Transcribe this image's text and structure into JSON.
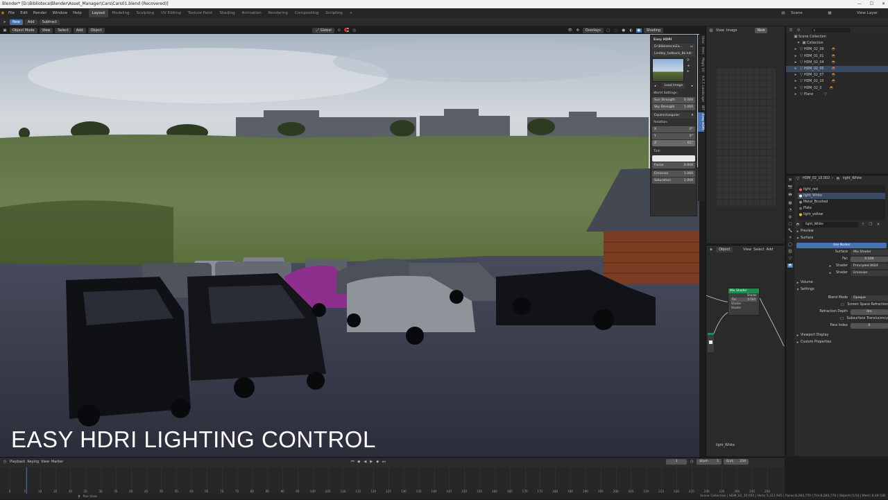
{
  "window": {
    "title": "Blender* [D:\\Biblioteca\\Blender\\Asset_Manager\\Cars\\Cars01.blend (Recovered)]"
  },
  "menu": [
    "File",
    "Edit",
    "Render",
    "Window",
    "Help"
  ],
  "workspaces": [
    "Layout",
    "Modeling",
    "Sculpting",
    "UV Editing",
    "Texture Paint",
    "Shading",
    "Animation",
    "Rendering",
    "Compositing",
    "Scripting"
  ],
  "top_right": {
    "scene": "Scene",
    "view_layer": "View Layer"
  },
  "toolbar": {
    "new": "New",
    "add": "Add",
    "subtract": "Subtract"
  },
  "viewport_header": {
    "mode": "Object Mode",
    "menus": [
      "View",
      "Select",
      "Add",
      "Object"
    ],
    "orientation": "Global",
    "overlays": "Overlays",
    "shading": "Shading"
  },
  "caption": "EASY HDRI LIGHTING CONTROL",
  "easy_hdri": {
    "panel_title": "Easy HDRI",
    "folder": "D:\\Biblioteca\\Ea...",
    "file": "Lindley_hotback_8k.hdr",
    "load_image": "Load Image",
    "world_settings": "World Settings:",
    "sun_strength_label": "Sun Strength",
    "sun_strength": "0.000",
    "sky_strength_label": "Sky Strength",
    "sky_strength": "1.000",
    "projection": "Equirectangular",
    "rotation_label": "Rotation:",
    "rot_x_label": "X",
    "rot_x": "0°",
    "rot_y_label": "Y",
    "rot_y": "0°",
    "rot_z_label": "Z",
    "rot_z": "61°",
    "tint_label": "Tint:",
    "factor_label": "Factor",
    "factor": "0.000",
    "emission_label": "Emission",
    "emission": "1.000",
    "saturation_label": "Saturation",
    "saturation": "1.000"
  },
  "npanel_tabs": [
    "Easy HDRI",
    "Tool",
    "Mult.Cmp.",
    "BIT",
    "A.R.T. Landscape",
    "Magic UV",
    "Item",
    "View"
  ],
  "image_editor": {
    "menus": [
      "View",
      "Image"
    ],
    "new": "New"
  },
  "node_editor": {
    "mode": "Object",
    "menus": [
      "View",
      "Select",
      "Add"
    ],
    "node_title": "Mix Shader",
    "socket_out": "Shader",
    "fac_label": "Fac",
    "fac": "0.500",
    "shader_a": "Shader",
    "shader_b": "Shader",
    "material_name": "light_White"
  },
  "outliner": {
    "collection_root": "Scene Collection",
    "items": [
      "Collection",
      "HDM_02_09",
      "HDM_01_01",
      "HDM_02_04",
      "HDM_02_05",
      "HDM_02_07",
      "HDM_02_10",
      "HDM_02_0",
      "Plane"
    ]
  },
  "properties": {
    "object": "HDM_02_10.002",
    "material": "light_White",
    "material_slots": [
      "light_red",
      "light_White",
      "Metal_Brushed",
      "Plate",
      "light_yellow"
    ],
    "material_field": "light_White",
    "sections": {
      "preview": "Preview",
      "surface": "Surface",
      "volume": "Volume",
      "settings": "Settings",
      "viewport_display": "Viewport Display",
      "custom_properties": "Custom Properties"
    },
    "use_nodes": "Use Nodes",
    "surface_label": "Surface",
    "surface_value": "Mix Shader",
    "fac_label": "Fac",
    "fac_value": "0.500",
    "shader1_label": "Shader",
    "shader1_value": "Principled BSDF",
    "shader2_label": "Shader",
    "shader2_value": "Emission",
    "blend_mode_label": "Blend Mode",
    "blend_mode": "Opaque",
    "ssr": "Screen Space Refraction",
    "refraction_depth_label": "Refraction Depth",
    "refraction_depth": "0m",
    "sss": "Subsurface Translucency",
    "pass_index_label": "Pass Index",
    "pass_index": "0"
  },
  "timeline": {
    "menus": [
      "Playback",
      "Keying",
      "View",
      "Marker"
    ],
    "current_frame": "1",
    "start_label": "Start:",
    "start": "1",
    "end_label": "End:",
    "end": "250",
    "ticks": [
      "0",
      "5",
      "10",
      "15",
      "20",
      "25",
      "30",
      "35",
      "40",
      "45",
      "50",
      "55",
      "60",
      "65",
      "70",
      "75",
      "80",
      "85",
      "90",
      "95",
      "100",
      "105",
      "110",
      "115",
      "120",
      "125",
      "130",
      "135",
      "140",
      "145",
      "150",
      "155",
      "160",
      "165",
      "170",
      "175",
      "180",
      "185",
      "190",
      "195",
      "200",
      "205",
      "210",
      "215",
      "220",
      "225",
      "230",
      "235",
      "240",
      "245",
      "250"
    ]
  },
  "status": {
    "left": "Pan View",
    "right": "Scene Collection | HDM_02_10.002 | Verts:5,311,945 | Faces:8,283,770 | Tris:8,283,770 | Objects:1/14 | Mem: 6.44 GiB"
  },
  "colors": {
    "accent_blue": "#4772b3",
    "selection": "#3b4a63",
    "node_green": "#1e8c4e"
  }
}
